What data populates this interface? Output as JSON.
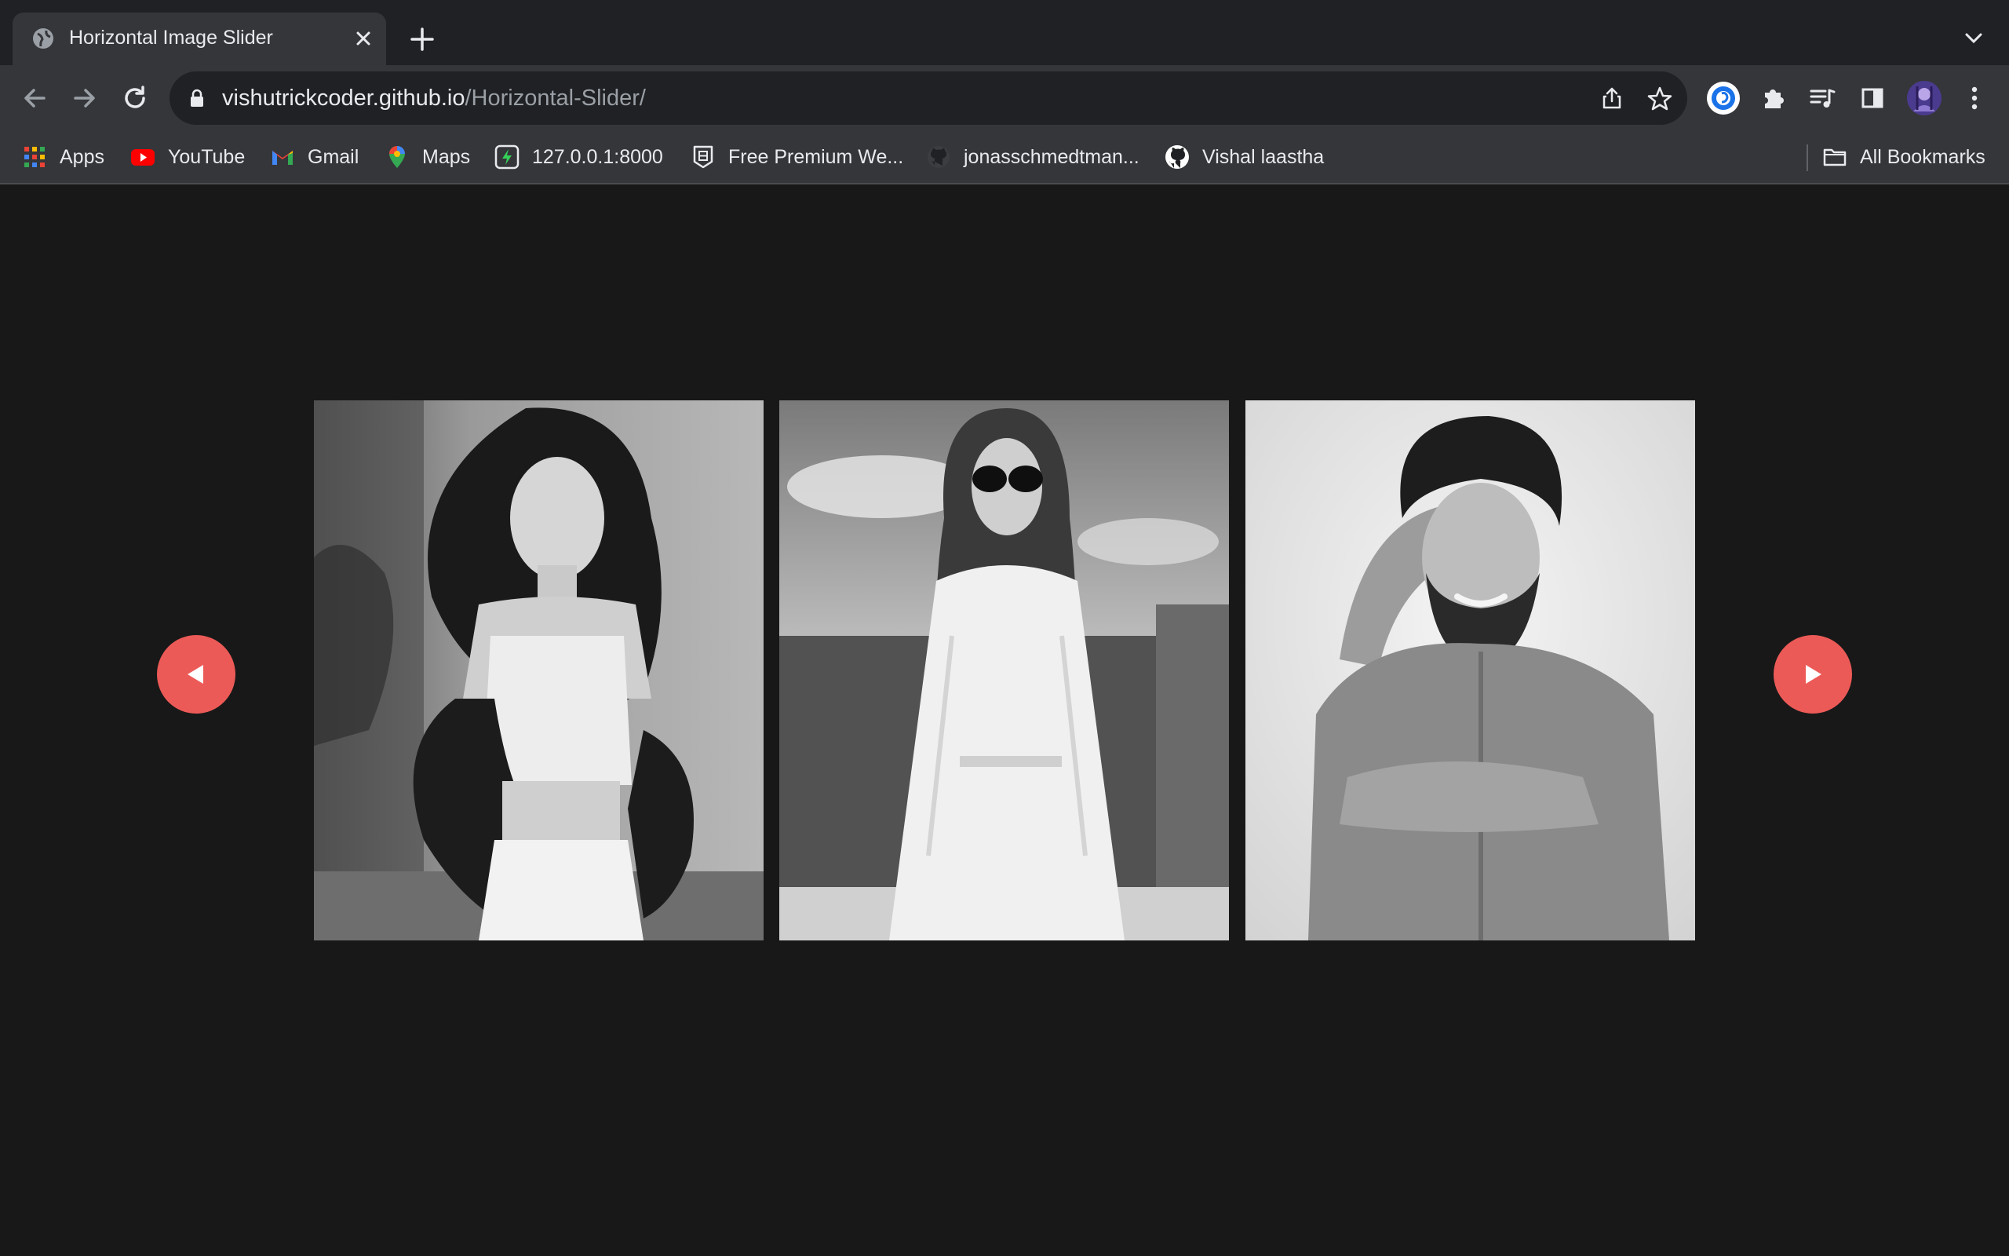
{
  "browser": {
    "tab": {
      "title": "Horizontal Image Slider"
    },
    "url": {
      "host": "vishutrickcoder.github.io",
      "path": "/Horizontal-Slider/"
    },
    "bookmarks": [
      {
        "label": "Apps",
        "icon": "apps-grid-icon"
      },
      {
        "label": "YouTube",
        "icon": "youtube-icon"
      },
      {
        "label": "Gmail",
        "icon": "gmail-icon"
      },
      {
        "label": "Maps",
        "icon": "maps-pin-icon"
      },
      {
        "label": "127.0.0.1:8000",
        "icon": "lightning-icon"
      },
      {
        "label": "Free Premium We...",
        "icon": "badge-icon"
      },
      {
        "label": "jonasschmedtman...",
        "icon": "github-icon"
      },
      {
        "label": "Vishal laastha",
        "icon": "github-icon"
      }
    ],
    "all_bookmarks_label": "All Bookmarks"
  },
  "slider": {
    "slides": [
      {
        "alt": "woman-with-curly-hair-photo"
      },
      {
        "alt": "woman-in-sunglasses-photo"
      },
      {
        "alt": "bearded-man-photo"
      }
    ],
    "prev_icon": "triangle-left-icon",
    "next_icon": "triangle-right-icon"
  },
  "colors": {
    "page_bg": "#181818",
    "button_red": "#ec5a57",
    "chrome_dark": "#202124",
    "chrome_toolbar": "#35363a"
  }
}
